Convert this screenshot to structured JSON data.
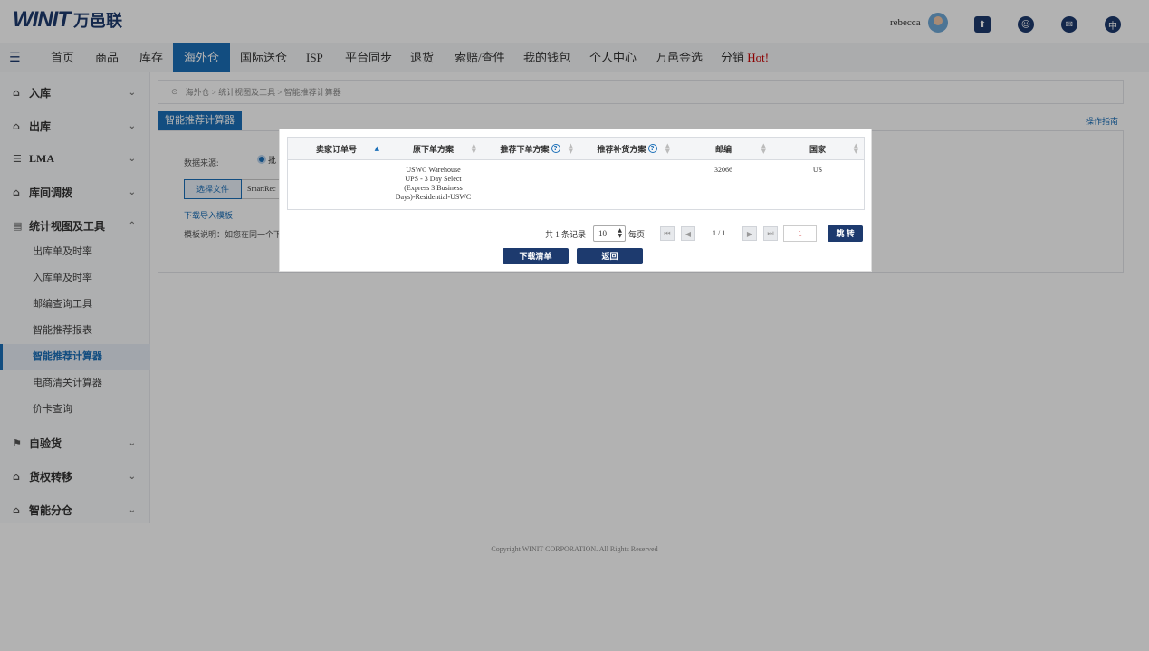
{
  "header": {
    "logo_text": "WINIT",
    "logo_cn": "万邑联",
    "username": "rebecca",
    "language_glyph": "中"
  },
  "nav": {
    "items": [
      "首页",
      "商品",
      "库存",
      "海外仓",
      "国际送仓",
      "ISP",
      "平台同步",
      "退货",
      "索赔/查件",
      "我的钱包",
      "个人中心",
      "万邑金选",
      "分销"
    ],
    "hot": "Hot!",
    "active": "海外仓"
  },
  "sidebar": {
    "groups": [
      "入库",
      "出库",
      "LMA",
      "库间调拨",
      "统计视图及工具",
      "自验货",
      "货权转移",
      "智能分仓"
    ],
    "subitems": [
      "出库单及时率",
      "入库单及时率",
      "邮编查询工具",
      "智能推荐报表",
      "智能推荐计算器",
      "电商清关计算器",
      "价卡查询"
    ],
    "active_sub": "智能推荐计算器"
  },
  "main": {
    "breadcrumb": "海外仓 > 统计视图及工具 > 智能推荐计算器",
    "tab_title": "智能推荐计算器",
    "guide_link": "操作指南",
    "data_source_label": "数据来源:",
    "radio_label": "批",
    "choose_file": "选择文件",
    "file_name": "SmartRec",
    "download_template": "下载导入模板",
    "template_note": "模板说明：如您在同一个下"
  },
  "modal": {
    "columns": [
      "卖家订单号",
      "原下单方案",
      "推荐下单方案",
      "推荐补货方案",
      "邮编",
      "国家"
    ],
    "rows": [
      {
        "order_no": "",
        "original_plan": "USWC Warehouse UPS - 3 Day Select (Express 3 Business Days)-Residential-USWC",
        "original_plan_lines": [
          "USWC Warehouse",
          "UPS - 3 Day Select",
          "(Express 3 Business",
          "Days)-Residential-USWC"
        ],
        "recommended_plan": "",
        "recommended_restock": "",
        "zip": "32066",
        "country": "US"
      }
    ],
    "pager": {
      "total": "共 1 条记录",
      "page_size": "10",
      "per_page": "每页",
      "page_info": "1 / 1",
      "page_input": "1",
      "go": "跳 转"
    },
    "download_btn": "下载清单",
    "back_btn": "返回"
  },
  "footer": {
    "copyright": "Copyright WINIT CORPORATION. All Rights Reserved"
  }
}
